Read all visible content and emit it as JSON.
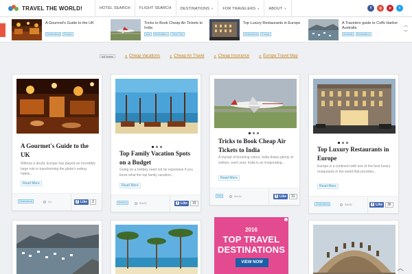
{
  "header": {
    "site_title": "TRAVEL THE WORLD!",
    "nav": [
      {
        "label": "HOTEL SEARCH",
        "has_caret": false
      },
      {
        "label": "FLIGHT SEARCH",
        "has_caret": false
      },
      {
        "label": "DESTINATIONS",
        "has_caret": true
      },
      {
        "label": "FOR TRAVELERS",
        "has_caret": true
      },
      {
        "label": "ABOUT",
        "has_caret": true
      }
    ],
    "socials": [
      {
        "icon": "facebook-icon",
        "glyph": "f",
        "color": "#3b5998"
      },
      {
        "icon": "google-plus-icon",
        "glyph": "g",
        "color": "#dd4b39"
      },
      {
        "icon": "pinterest-icon",
        "glyph": "p",
        "color": "#cb2027"
      },
      {
        "icon": "twitter-icon",
        "glyph": "t",
        "color": "#1da1f2"
      }
    ]
  },
  "ticker": {
    "items": [
      {
        "title": "A Gourmet's Guide to the UK",
        "tags": [
          "Destinations",
          "Europe"
        ]
      },
      {
        "title": "Tricks to Book Cheap Air Tickets to India",
        "tags": [
          "Asia",
          "Destinations",
          "Travel Tips"
        ]
      },
      {
        "title": "Top Luxury Restaurants in Europe",
        "tags": [
          "Destinations",
          "Europe"
        ]
      },
      {
        "title": "A Travelers guide to Coffs Harbor Australia",
        "tags": [
          "Australia",
          "Destinations"
        ]
      }
    ]
  },
  "ads": {
    "adchoices": "AdChoices",
    "links": [
      "Cheap Vacations",
      "Cheap Air Travel",
      "Cheap Insurance",
      "Europe Travel Map"
    ]
  },
  "cards": [
    {
      "title": "A Gourmet's Guide to the UK",
      "excerpt": "Without a doubt, Europe has played an incredibly large role in transforming the globe's eating habits...",
      "read_more": "Read More",
      "tag": "Destinations",
      "date": "2/1",
      "likes": "3"
    },
    {
      "title": "Top Family Vacation Spots on a Budget",
      "excerpt": "Going on a holiday need not be expensive if you know what the top family vacation...",
      "read_more": "Read More",
      "tag": "America",
      "date": "3/4/21",
      "likes": "15"
    },
    {
      "title": "Tricks to Book Cheap Air Tickets to India",
      "excerpt": "A myriad of booming colors, India draws plenty of visitors, each year. India is an invigorating...",
      "read_more": "Read More",
      "tag": "Asia",
      "date": "3/4/14",
      "likes": "31"
    },
    {
      "title": "Top Luxury Restaurants in Europe",
      "excerpt": "Europe is a continent with one of the best luxury restaurants in the world that provides...",
      "read_more": "Read More",
      "tag": "Destinations",
      "date": "3/4/20",
      "likes": "36"
    }
  ],
  "like_label": "Like",
  "ad_card": {
    "year": "2016",
    "line1": "TOP TRAVEL",
    "line2": "DESTINATIONS",
    "button": "VIEW NOW"
  },
  "colors": {
    "accent": "#2b8fbf",
    "ad_link": "#c1851f",
    "ad_card_bg": "#e34a8f",
    "ad_button": "#1a5fa8",
    "facebook": "#4267b2"
  }
}
